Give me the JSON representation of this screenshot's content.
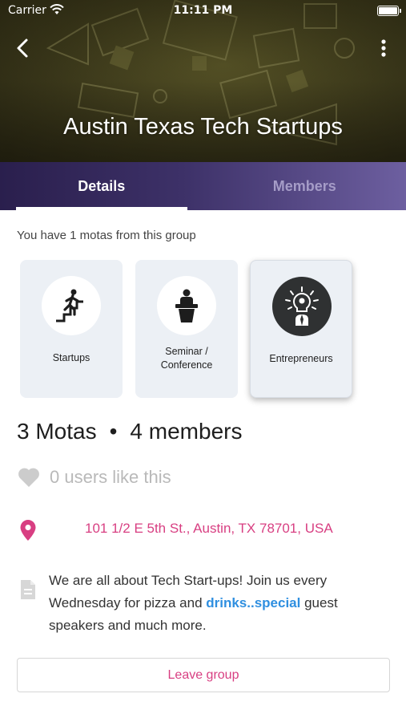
{
  "status_bar": {
    "carrier": "Carrier",
    "time": "11:11 PM"
  },
  "header": {
    "title": "Austin Texas Tech Startups"
  },
  "tabs": [
    {
      "label": "Details",
      "active": true
    },
    {
      "label": "Members",
      "active": false
    }
  ],
  "subtitle": "You have 1 motas from this group",
  "cards": [
    {
      "label": "Startups",
      "icon": "stairs-climber-icon",
      "selected": false
    },
    {
      "label": "Seminar / Conference",
      "icon": "podium-speaker-icon",
      "selected": false
    },
    {
      "label": "Entrepreneurs",
      "icon": "lightbulb-person-icon",
      "selected": true
    }
  ],
  "stats": {
    "motas": "3 Motas",
    "separator": "•",
    "members": "4 members"
  },
  "likes": {
    "text": "0 users like this",
    "icon": "heart-icon"
  },
  "address": {
    "text": "101 1/2 E 5th St., Austin, TX 78701, USA",
    "icon": "location-pin-icon"
  },
  "description": {
    "before": "We are all about Tech Start-ups! Join us every Wednesday for pizza and ",
    "highlight": "drinks..special",
    "after": " guest speakers and much more."
  },
  "leave_button": {
    "label": "Leave group"
  },
  "colors": {
    "accent": "#d83f82",
    "link": "#2f8fe0",
    "tab_bar": "#3d3168"
  }
}
